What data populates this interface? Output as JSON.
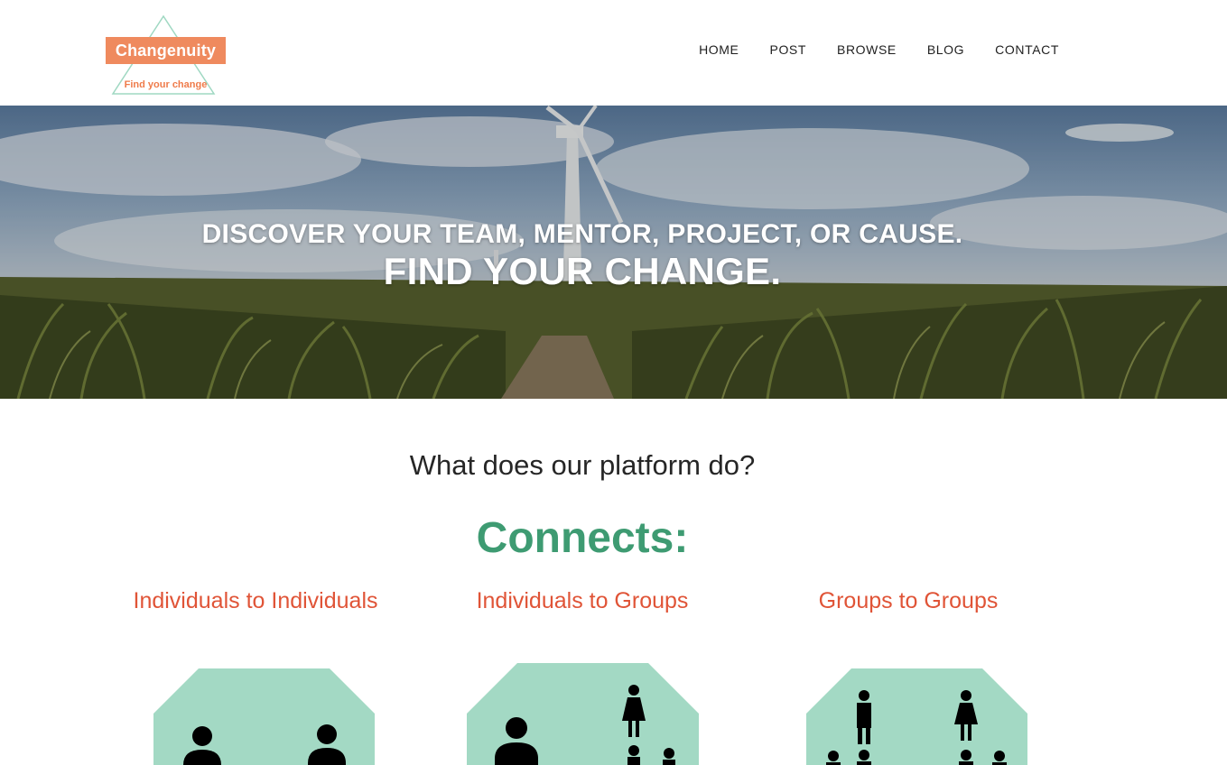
{
  "brand": {
    "name": "Changenuity",
    "tagline": "Find your change",
    "box_color": "#ef8a5e",
    "triangle_color": "#9fd8c2"
  },
  "nav": {
    "items": [
      {
        "label": "HOME"
      },
      {
        "label": "POST"
      },
      {
        "label": "BROWSE"
      },
      {
        "label": "BLOG"
      },
      {
        "label": "CONTACT"
      }
    ]
  },
  "hero": {
    "line1": "DISCOVER YOUR TEAM, MENTOR, PROJECT, OR CAUSE.",
    "line2": "FIND YOUR CHANGE."
  },
  "section": {
    "question": "What does our platform do?",
    "connects": "Connects:",
    "columns": [
      {
        "title": "Individuals to Individuals",
        "icon": "people-pair-icon"
      },
      {
        "title": "Individuals to Groups",
        "icon": "person-to-group-icon"
      },
      {
        "title": "Groups to Groups",
        "icon": "group-to-group-icon"
      }
    ]
  },
  "colors": {
    "accent_green": "#3e9b72",
    "accent_red": "#e05437",
    "octagon_fill": "#a3d9c4"
  }
}
